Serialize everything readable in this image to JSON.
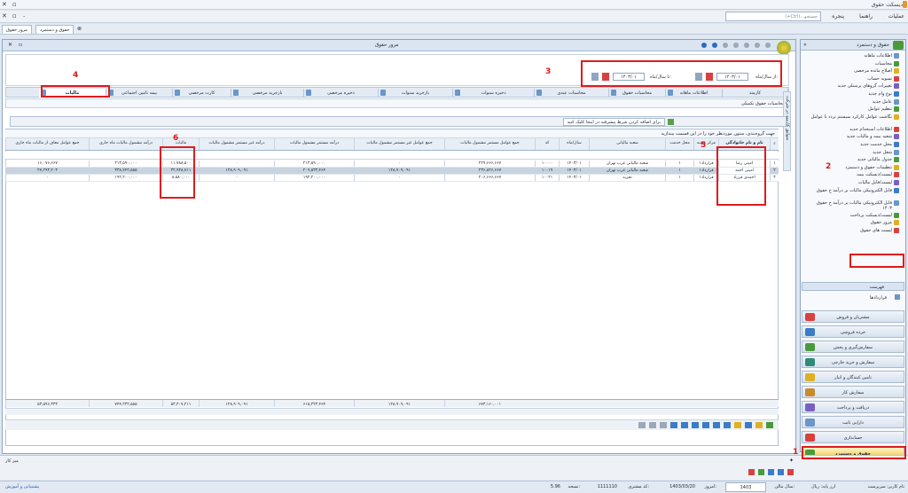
{
  "window": {
    "title": "دیسکت حقوق"
  },
  "menu": {
    "items": [
      "عملیات",
      "راهنما",
      "پنجره"
    ],
    "search_placeholder": "جستجو...(Ctrl+)"
  },
  "doc_tabs": [
    "مرور حقوق",
    "حقوق و دستمزد"
  ],
  "main": {
    "title": "مرور حقوق"
  },
  "params": {
    "from_label": "از سال/ماه:",
    "from_value": "۱۴۰۳/۰۱",
    "to_label": "تا سال/ماه:",
    "to_value": "۱۴۰۳/۰۱"
  },
  "tabs": [
    "کارمند",
    "اطلاعات ماهانه",
    "محاسبات حقوق",
    "محاسبات عیدی",
    "ذخیره سنوات",
    "بازخرید سنوات",
    "ذخیره مرخصی",
    "بازخرید مرخصی",
    "کارت مرخصی",
    "بیمه تامین اجتماعی",
    "مالیات"
  ],
  "sub_tab": "محاسبات حقوق تکمیلی",
  "side_tab": "سوابق کارمند در شرکت",
  "filter_bar": {
    "text": "برای اضافه کردن شرط پیشرفته در اینجا کلیک کنید"
  },
  "group_hint": "جهت گروه‌بندی، ستون موردنظر خود را در این قسمت بیندازید",
  "table": {
    "headers": [
      "نام و نام خانوادگی",
      "مرکز هزینه",
      "محل خدمت",
      "شعبه مالیاتی",
      "سال/ماه",
      "کد",
      "جمع عوامل مستمر مشمول مالیات",
      "جمع عوامل غیر مستمر مشمول مالیات",
      "درآمد مستمر مشمول مالیات",
      "درآمد غیر مستمر مشمول مالیات",
      "مالیات",
      "درآمد مشمول مالیات ماه جاری",
      "جمع عوامل معاف از مالیات ماه جاری"
    ],
    "rows": [
      {
        "idx": "۱",
        "name": "امینی رضا",
        "center": "قرارداد۱",
        "place": "۱",
        "branch": "شعبه مالیاتی غرب تهران",
        "ym": "۱۴۰۳/۰۱",
        "code": "۱۰۰۰۰",
        "c1": "۲۲۹,۶۶۶,۶۶۷",
        "c2": "۰",
        "c3": "۲۱۳,۵۹۰,۰۰۰",
        "c4": "۰",
        "tax": "۱۱,۷۸۸,۵۰۰",
        "c6": "۲۱۳,۵۹۰,۰۰۰",
        "c7": "۱۶,۰۷۶,۶۶۷"
      },
      {
        "idx": "۲",
        "name": "امینی احمد",
        "center": "قرارداد۱",
        "place": "۱",
        "branch": "شعبه مالیاتی غرب تهران",
        "ym": "۱۴۰۳/۰۱",
        "code": "۱۰۰۱۹",
        "c1": "۲۳۶,۸۲۶,۶۶۷",
        "c2": "۱۲۸,۹۰۹,۰۹۱",
        "c3": "۲۰۹,۵۳۳,۴۶۴",
        "c4": "۱۲۸,۹۰۹,۰۹۱",
        "tax": "۳۲,۹۳۸,۷۱۱",
        "c6": "۳۳۸,۴۴۲,۵۵۵",
        "c7": "۲۷,۲۹۳,۲۰۳"
      },
      {
        "idx": "۳",
        "name": "احمدی فرزاد",
        "center": "قرارداد۱",
        "place": "۱",
        "branch": "تجربه",
        "ym": "۱۴۰۳/۰۱",
        "code": "۱۰۰۲۱",
        "c1": "۲۰۶,۶۶۶,۶۶۷",
        "c2": "۰",
        "c3": "۱۹۲,۲۰۰,۰۰۰",
        "c4": "۰",
        "tax": "۸,۵۸۰,۰۰۰",
        "c6": "۱۹۲,۲۰۰,۰۰۰",
        "c7": "۰"
      }
    ],
    "totals": {
      "c1": "۶۷۳,۱۶۰,۰۰۱",
      "c2": "۱۲۸,۹۰۹,۰۹۱",
      "c3": "۶۱۵,۳۲۳,۴۶۴",
      "c4": "۱۲۸,۹۰۹,۰۹۱",
      "tax": "۵۳,۳۰۷,۲۱۱",
      "c6": "۷۴۴,۲۳۲,۵۵۵",
      "c7": "۵۳,۵۹۶,۳۳۳"
    }
  },
  "sidebar": {
    "header": "حقوق و دستمزد",
    "items": [
      "اطلاعات ماهانه",
      "محاسبات",
      "اصلاح مانده مرخصی",
      "تسویه حساب",
      "تغییرات گروهای پرسنلی جدید",
      "نوع وام جدید",
      "عامل جدید",
      "تنظیم عوامل",
      "نگاشت عوامل کارکرد سیستم تردد با عوامل",
      "اطلاعات استخدام جدید",
      "شعبه بیمه و مالیات جدید",
      "محل خدمت جدید",
      "شغل جدید",
      "جدول مالیاتی جدید",
      "تنظیمات حقوق و دستمزد",
      "لیست/دیسکت بیمه",
      "لیست/فایل مالیات",
      "فایل الکترونیکی مالیات بر درآمد ح حقوق",
      "فایل الکترونیکی مالیات بر درآمد ح حقوق ۱۴۰۳",
      "لیست/دیسکت پرداخت",
      "مرور حقوق",
      "لیست های حقوق"
    ],
    "section2": "فهرست",
    "section2_item": "قراردادها"
  },
  "modules": [
    "مشتریان و فروش",
    "خرده فروشی",
    "سفارش‌گیری و پخش",
    "سفارش و خرید خارجی",
    "تامین کنندگان و انبار",
    "سفارش کار",
    "دریافت و پرداخت",
    "دارایی ثابت",
    "حسابداری",
    "حقوق و دستمزد"
  ],
  "footer": {
    "label": "میز کار"
  },
  "status": {
    "user": "نام کاربر: سرپرست",
    "base": "ارز پایه: ریال",
    "fiscal_label": "سال مالی:",
    "fiscal_value": "1403",
    "today_label": "امروز:",
    "today_value": "1403/03/20",
    "customer_label": "کد مشتری:",
    "customer_value": "1111110",
    "version_label": "نسخه:",
    "version_value": "5.96",
    "support": "پشتیبانی و آموزش"
  },
  "annotations": [
    "1",
    "2",
    "3",
    "4",
    "5",
    "6"
  ]
}
